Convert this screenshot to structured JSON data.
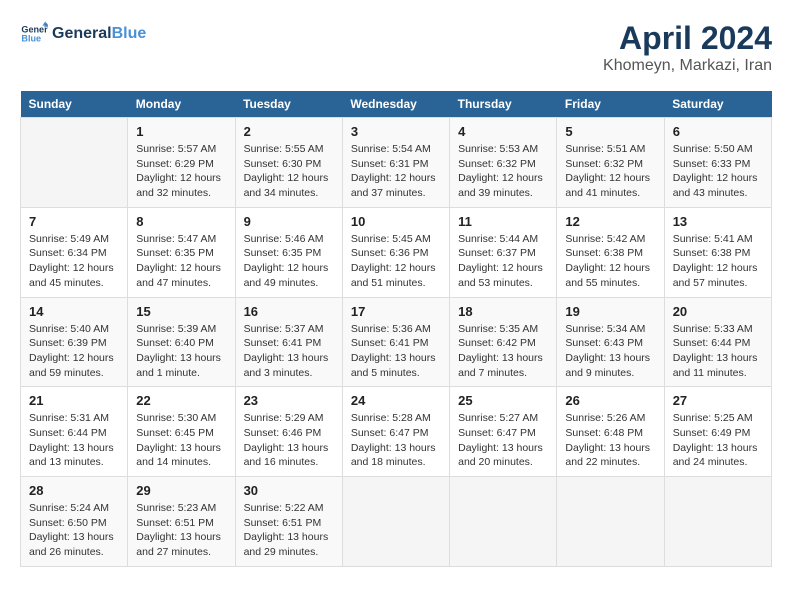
{
  "header": {
    "logo_line1": "General",
    "logo_line2": "Blue",
    "title": "April 2024",
    "subtitle": "Khomeyn, Markazi, Iran"
  },
  "calendar": {
    "days_of_week": [
      "Sunday",
      "Monday",
      "Tuesday",
      "Wednesday",
      "Thursday",
      "Friday",
      "Saturday"
    ],
    "weeks": [
      [
        {
          "day": "",
          "info": ""
        },
        {
          "day": "1",
          "info": "Sunrise: 5:57 AM\nSunset: 6:29 PM\nDaylight: 12 hours\nand 32 minutes."
        },
        {
          "day": "2",
          "info": "Sunrise: 5:55 AM\nSunset: 6:30 PM\nDaylight: 12 hours\nand 34 minutes."
        },
        {
          "day": "3",
          "info": "Sunrise: 5:54 AM\nSunset: 6:31 PM\nDaylight: 12 hours\nand 37 minutes."
        },
        {
          "day": "4",
          "info": "Sunrise: 5:53 AM\nSunset: 6:32 PM\nDaylight: 12 hours\nand 39 minutes."
        },
        {
          "day": "5",
          "info": "Sunrise: 5:51 AM\nSunset: 6:32 PM\nDaylight: 12 hours\nand 41 minutes."
        },
        {
          "day": "6",
          "info": "Sunrise: 5:50 AM\nSunset: 6:33 PM\nDaylight: 12 hours\nand 43 minutes."
        }
      ],
      [
        {
          "day": "7",
          "info": "Sunrise: 5:49 AM\nSunset: 6:34 PM\nDaylight: 12 hours\nand 45 minutes."
        },
        {
          "day": "8",
          "info": "Sunrise: 5:47 AM\nSunset: 6:35 PM\nDaylight: 12 hours\nand 47 minutes."
        },
        {
          "day": "9",
          "info": "Sunrise: 5:46 AM\nSunset: 6:35 PM\nDaylight: 12 hours\nand 49 minutes."
        },
        {
          "day": "10",
          "info": "Sunrise: 5:45 AM\nSunset: 6:36 PM\nDaylight: 12 hours\nand 51 minutes."
        },
        {
          "day": "11",
          "info": "Sunrise: 5:44 AM\nSunset: 6:37 PM\nDaylight: 12 hours\nand 53 minutes."
        },
        {
          "day": "12",
          "info": "Sunrise: 5:42 AM\nSunset: 6:38 PM\nDaylight: 12 hours\nand 55 minutes."
        },
        {
          "day": "13",
          "info": "Sunrise: 5:41 AM\nSunset: 6:38 PM\nDaylight: 12 hours\nand 57 minutes."
        }
      ],
      [
        {
          "day": "14",
          "info": "Sunrise: 5:40 AM\nSunset: 6:39 PM\nDaylight: 12 hours\nand 59 minutes."
        },
        {
          "day": "15",
          "info": "Sunrise: 5:39 AM\nSunset: 6:40 PM\nDaylight: 13 hours\nand 1 minute."
        },
        {
          "day": "16",
          "info": "Sunrise: 5:37 AM\nSunset: 6:41 PM\nDaylight: 13 hours\nand 3 minutes."
        },
        {
          "day": "17",
          "info": "Sunrise: 5:36 AM\nSunset: 6:41 PM\nDaylight: 13 hours\nand 5 minutes."
        },
        {
          "day": "18",
          "info": "Sunrise: 5:35 AM\nSunset: 6:42 PM\nDaylight: 13 hours\nand 7 minutes."
        },
        {
          "day": "19",
          "info": "Sunrise: 5:34 AM\nSunset: 6:43 PM\nDaylight: 13 hours\nand 9 minutes."
        },
        {
          "day": "20",
          "info": "Sunrise: 5:33 AM\nSunset: 6:44 PM\nDaylight: 13 hours\nand 11 minutes."
        }
      ],
      [
        {
          "day": "21",
          "info": "Sunrise: 5:31 AM\nSunset: 6:44 PM\nDaylight: 13 hours\nand 13 minutes."
        },
        {
          "day": "22",
          "info": "Sunrise: 5:30 AM\nSunset: 6:45 PM\nDaylight: 13 hours\nand 14 minutes."
        },
        {
          "day": "23",
          "info": "Sunrise: 5:29 AM\nSunset: 6:46 PM\nDaylight: 13 hours\nand 16 minutes."
        },
        {
          "day": "24",
          "info": "Sunrise: 5:28 AM\nSunset: 6:47 PM\nDaylight: 13 hours\nand 18 minutes."
        },
        {
          "day": "25",
          "info": "Sunrise: 5:27 AM\nSunset: 6:47 PM\nDaylight: 13 hours\nand 20 minutes."
        },
        {
          "day": "26",
          "info": "Sunrise: 5:26 AM\nSunset: 6:48 PM\nDaylight: 13 hours\nand 22 minutes."
        },
        {
          "day": "27",
          "info": "Sunrise: 5:25 AM\nSunset: 6:49 PM\nDaylight: 13 hours\nand 24 minutes."
        }
      ],
      [
        {
          "day": "28",
          "info": "Sunrise: 5:24 AM\nSunset: 6:50 PM\nDaylight: 13 hours\nand 26 minutes."
        },
        {
          "day": "29",
          "info": "Sunrise: 5:23 AM\nSunset: 6:51 PM\nDaylight: 13 hours\nand 27 minutes."
        },
        {
          "day": "30",
          "info": "Sunrise: 5:22 AM\nSunset: 6:51 PM\nDaylight: 13 hours\nand 29 minutes."
        },
        {
          "day": "",
          "info": ""
        },
        {
          "day": "",
          "info": ""
        },
        {
          "day": "",
          "info": ""
        },
        {
          "day": "",
          "info": ""
        }
      ]
    ]
  }
}
